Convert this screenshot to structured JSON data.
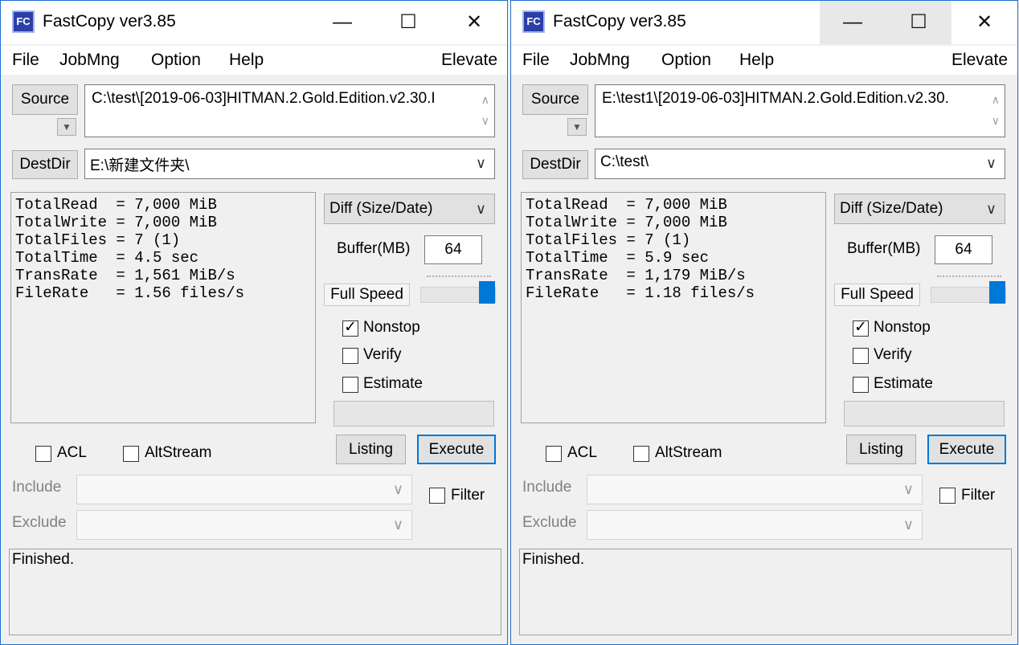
{
  "windows": [
    {
      "title": "FastCopy ver3.85",
      "menu": [
        "File",
        "JobMng",
        "Option",
        "Help"
      ],
      "elevate": "Elevate",
      "source_label": "Source",
      "source_path": "C:\\test\\[2019-06-03]HITMAN.2.Gold.Edition.v2.30.I",
      "destdir_label": "DestDir",
      "dest_path": "E:\\新建文件夹\\",
      "stats": [
        "TotalRead  = 7,000 MiB",
        "TotalWrite = 7,000 MiB",
        "TotalFiles = 7 (1)",
        "TotalTime  = 4.5 sec",
        "TransRate  = 1,561 MiB/s",
        "FileRate   = 1.56 files/s"
      ],
      "mode": "Diff (Size/Date)",
      "buffer_label": "Buffer(MB)",
      "buffer_value": "64",
      "speed_label": "Full Speed",
      "speed_level": 1.0,
      "nonstop": {
        "label": "Nonstop",
        "checked": true
      },
      "verify": {
        "label": "Verify",
        "checked": false
      },
      "estimate": {
        "label": "Estimate",
        "checked": false
      },
      "acl": {
        "label": "ACL",
        "checked": false
      },
      "altstream": {
        "label": "AltStream",
        "checked": false
      },
      "listing_label": "Listing",
      "execute_label": "Execute",
      "include_label": "Include",
      "exclude_label": "Exclude",
      "filter": {
        "label": "Filter",
        "checked": false
      },
      "status": "Finished."
    },
    {
      "title": "FastCopy ver3.85",
      "menu": [
        "File",
        "JobMng",
        "Option",
        "Help"
      ],
      "elevate": "Elevate",
      "source_label": "Source",
      "source_path": "E:\\test1\\[2019-06-03]HITMAN.2.Gold.Edition.v2.30.",
      "destdir_label": "DestDir",
      "dest_path": "C:\\test\\",
      "stats": [
        "TotalRead  = 7,000 MiB",
        "TotalWrite = 7,000 MiB",
        "TotalFiles = 7 (1)",
        "TotalTime  = 5.9 sec",
        "TransRate  = 1,179 MiB/s",
        "FileRate   = 1.18 files/s"
      ],
      "mode": "Diff (Size/Date)",
      "buffer_label": "Buffer(MB)",
      "buffer_value": "64",
      "speed_label": "Full Speed",
      "speed_level": 1.0,
      "nonstop": {
        "label": "Nonstop",
        "checked": true
      },
      "verify": {
        "label": "Verify",
        "checked": false
      },
      "estimate": {
        "label": "Estimate",
        "checked": false
      },
      "acl": {
        "label": "ACL",
        "checked": false
      },
      "altstream": {
        "label": "AltStream",
        "checked": false
      },
      "listing_label": "Listing",
      "execute_label": "Execute",
      "include_label": "Include",
      "exclude_label": "Exclude",
      "filter": {
        "label": "Filter",
        "checked": false
      },
      "status": "Finished."
    }
  ],
  "icons": {
    "app": "fastcopy-app-icon",
    "minimize": "minimize-icon",
    "maximize": "maximize-icon",
    "close": "close-icon",
    "dropdown": "chevron-down-icon",
    "check": "checkmark-icon"
  },
  "colors": {
    "accent": "#0078d7",
    "window_border": "#1e6fd0",
    "background": "#f0f0f0"
  }
}
